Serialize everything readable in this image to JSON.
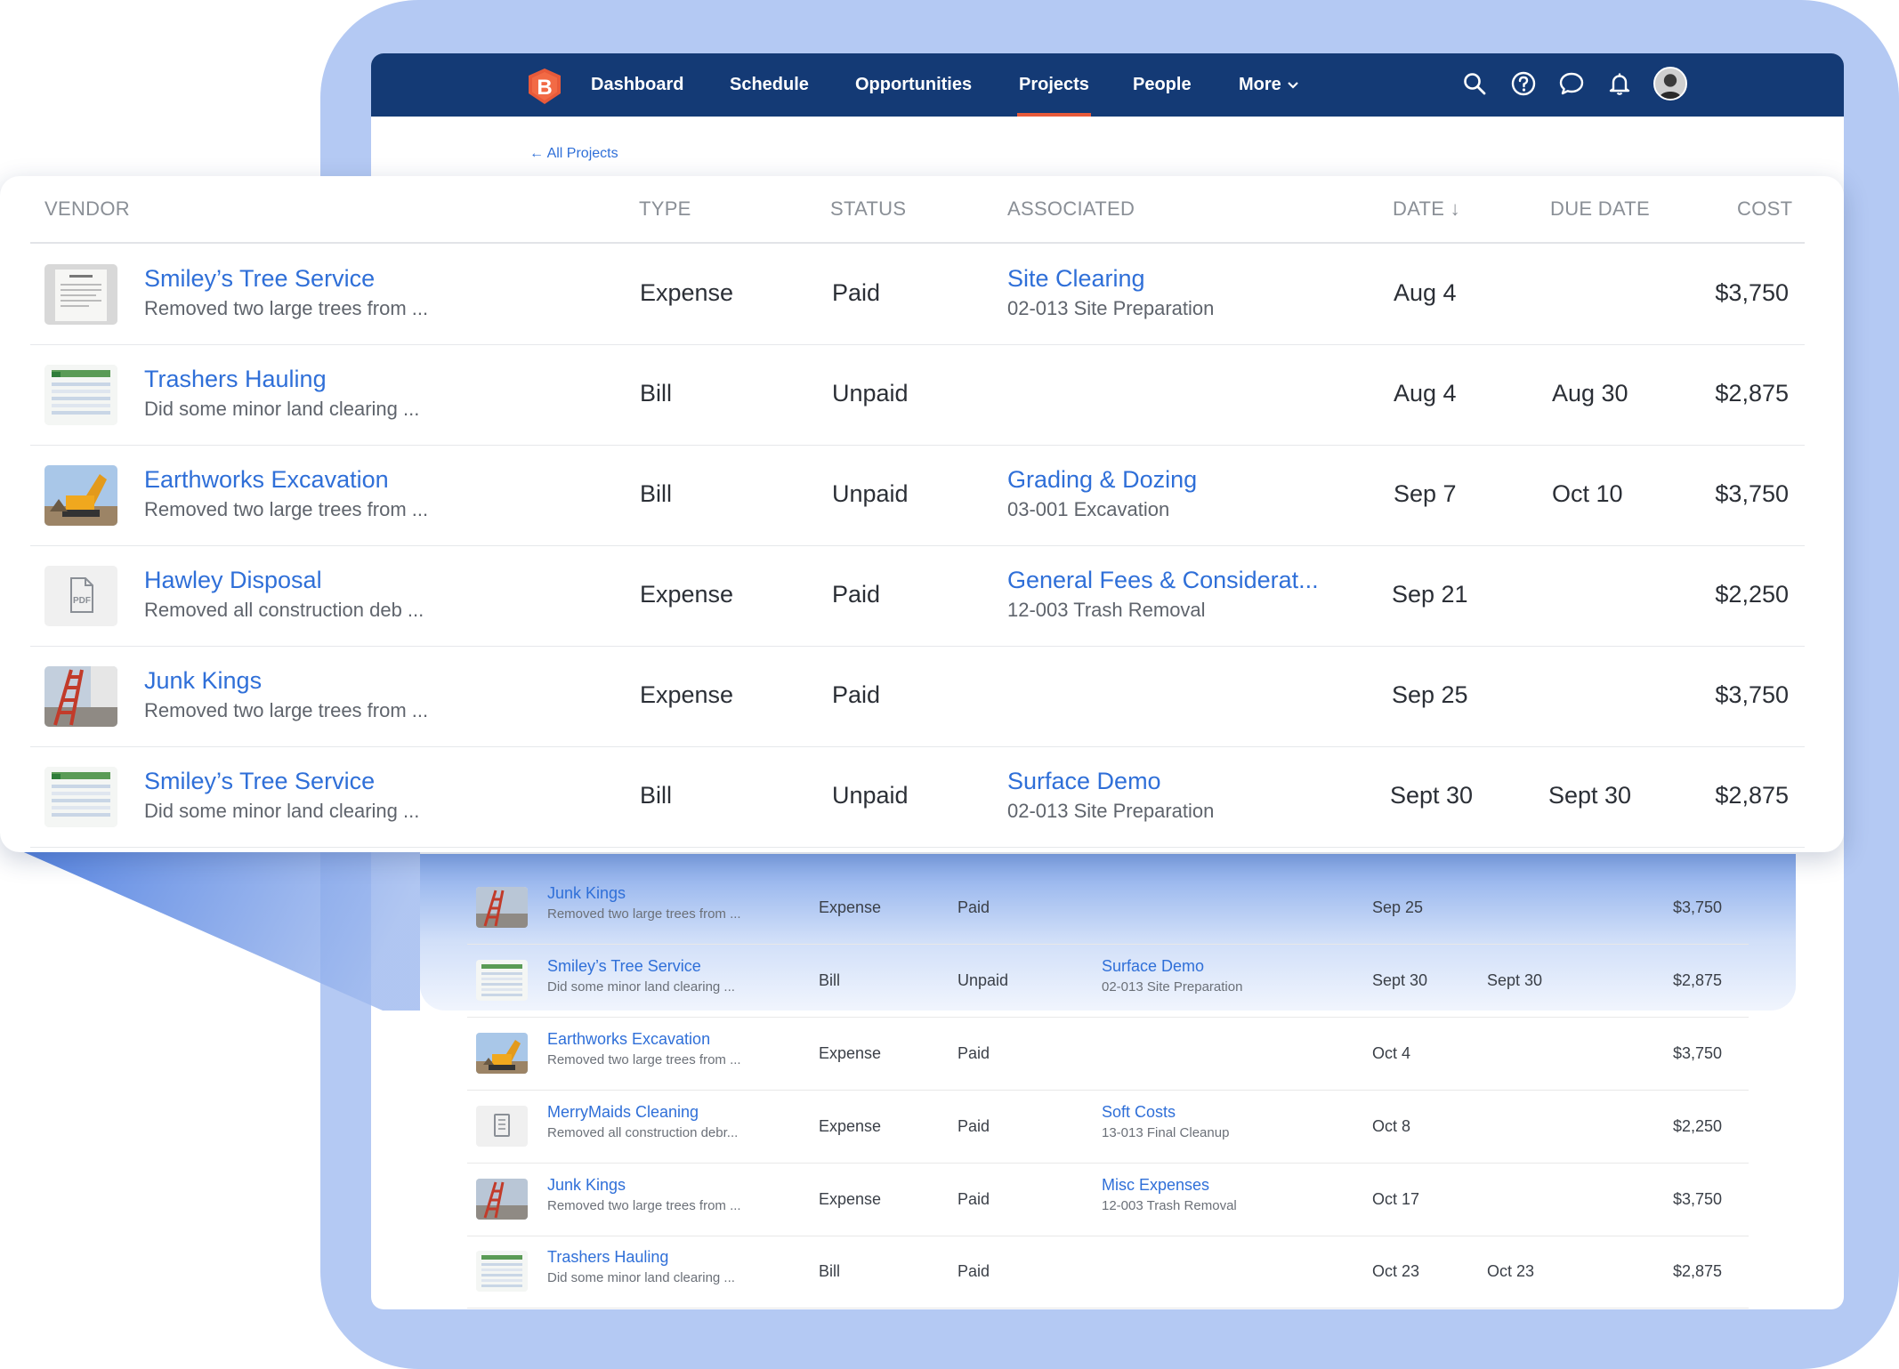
{
  "nav": {
    "logo_letter": "B",
    "items": [
      {
        "label": "Dashboard"
      },
      {
        "label": "Schedule"
      },
      {
        "label": "Opportunities"
      },
      {
        "label": "Projects"
      },
      {
        "label": "People"
      },
      {
        "label": "More"
      }
    ],
    "active_item": "Projects",
    "icons": [
      "search-icon",
      "help-icon",
      "chat-icon",
      "bell-icon",
      "avatar"
    ]
  },
  "breadcrumb": {
    "back_label": "← All Projects"
  },
  "table": {
    "headers": {
      "vendor": "VENDOR",
      "type": "TYPE",
      "status": "STATUS",
      "associated": "ASSOCIATED",
      "date": "DATE ↓",
      "due_date": "DUE DATE",
      "cost": "COST"
    },
    "rows": [
      {
        "thumb": "document-thumbnail",
        "vendor": "Smiley’s Tree Service",
        "desc": "Removed two large trees from ...",
        "type": "Expense",
        "status": "Paid",
        "assoc_name": "Site Clearing",
        "assoc_code": "02-013 Site Preparation",
        "date": "Aug 4",
        "due": "",
        "cost": "$3,750"
      },
      {
        "thumb": "spreadsheet-thumbnail",
        "vendor": "Trashers Hauling",
        "desc": "Did some minor land clearing ...",
        "type": "Bill",
        "status": "Unpaid",
        "assoc_name": "",
        "assoc_code": "",
        "date": "Aug 4",
        "due": "Aug 30",
        "cost": "$2,875"
      },
      {
        "thumb": "excavator-photo",
        "vendor": "Earthworks Excavation",
        "desc": "Removed two large trees from ...",
        "type": "Bill",
        "status": "Unpaid",
        "assoc_name": "Grading & Dozing",
        "assoc_code": "03-001 Excavation",
        "date": "Sep 7",
        "due": "Oct 10",
        "cost": "$3,750"
      },
      {
        "thumb": "pdf-icon",
        "vendor": "Hawley Disposal",
        "desc": "Removed all construction deb ...",
        "type": "Expense",
        "status": "Paid",
        "assoc_name": "General Fees & Considerat...",
        "assoc_code": "12-003 Trash Removal",
        "date": "Sep 21",
        "due": "",
        "cost": "$2,250"
      },
      {
        "thumb": "ladder-photo",
        "vendor": "Junk Kings",
        "desc": "Removed two large trees from ...",
        "type": "Expense",
        "status": "Paid",
        "assoc_name": "",
        "assoc_code": "",
        "date": "Sep 25",
        "due": "",
        "cost": "$3,750"
      },
      {
        "thumb": "spreadsheet-thumbnail",
        "vendor": "Smiley’s Tree Service",
        "desc": "Did some minor land clearing ...",
        "type": "Bill",
        "status": "Unpaid",
        "assoc_name": "Surface Demo",
        "assoc_code": "02-013 Site Preparation",
        "date": "Sept 30",
        "due": "Sept 30",
        "cost": "$2,875"
      }
    ]
  },
  "background_table": {
    "rows": [
      {
        "thumb": "ladder-photo",
        "vendor": "Junk Kings",
        "desc": "Removed two large trees from ...",
        "type": "Expense",
        "status": "Paid",
        "assoc_name": "",
        "assoc_code": "",
        "date": "Sep 25",
        "due": "",
        "cost": "$3,750"
      },
      {
        "thumb": "spreadsheet-thumbnail",
        "vendor": "Smiley’s Tree Service",
        "desc": "Did some minor land clearing ...",
        "type": "Bill",
        "status": "Unpaid",
        "assoc_name": "Surface Demo",
        "assoc_code": "02-013 Site Preparation",
        "date": "Sept 30",
        "due": "Sept 30",
        "cost": "$2,875"
      },
      {
        "thumb": "excavator-photo",
        "vendor": "Earthworks Excavation",
        "desc": "Removed two large trees from ...",
        "type": "Expense",
        "status": "Paid",
        "assoc_name": "",
        "assoc_code": "",
        "date": "Oct 4",
        "due": "",
        "cost": "$3,750"
      },
      {
        "thumb": "receipt-icon",
        "vendor": "MerryMaids Cleaning",
        "desc": "Removed all construction debr...",
        "type": "Expense",
        "status": "Paid",
        "assoc_name": "Soft Costs",
        "assoc_code": "13-013 Final Cleanup",
        "date": "Oct 8",
        "due": "",
        "cost": "$2,250"
      },
      {
        "thumb": "ladder-photo",
        "vendor": "Junk Kings",
        "desc": "Removed two large trees from ...",
        "type": "Expense",
        "status": "Paid",
        "assoc_name": "Misc Expenses",
        "assoc_code": "12-003 Trash Removal",
        "date": "Oct 17",
        "due": "",
        "cost": "$3,750"
      },
      {
        "thumb": "spreadsheet-thumbnail",
        "vendor": "Trashers Hauling",
        "desc": "Did some minor land clearing ...",
        "type": "Bill",
        "status": "Paid",
        "assoc_name": "",
        "assoc_code": "",
        "date": "Oct 23",
        "due": "Oct 23",
        "cost": "$2,875"
      }
    ]
  },
  "colors": {
    "nav_bg": "#143a75",
    "accent_orange": "#e85a3a",
    "link_blue": "#2f6fd8",
    "backdrop_blue": "#b4c9f3"
  }
}
